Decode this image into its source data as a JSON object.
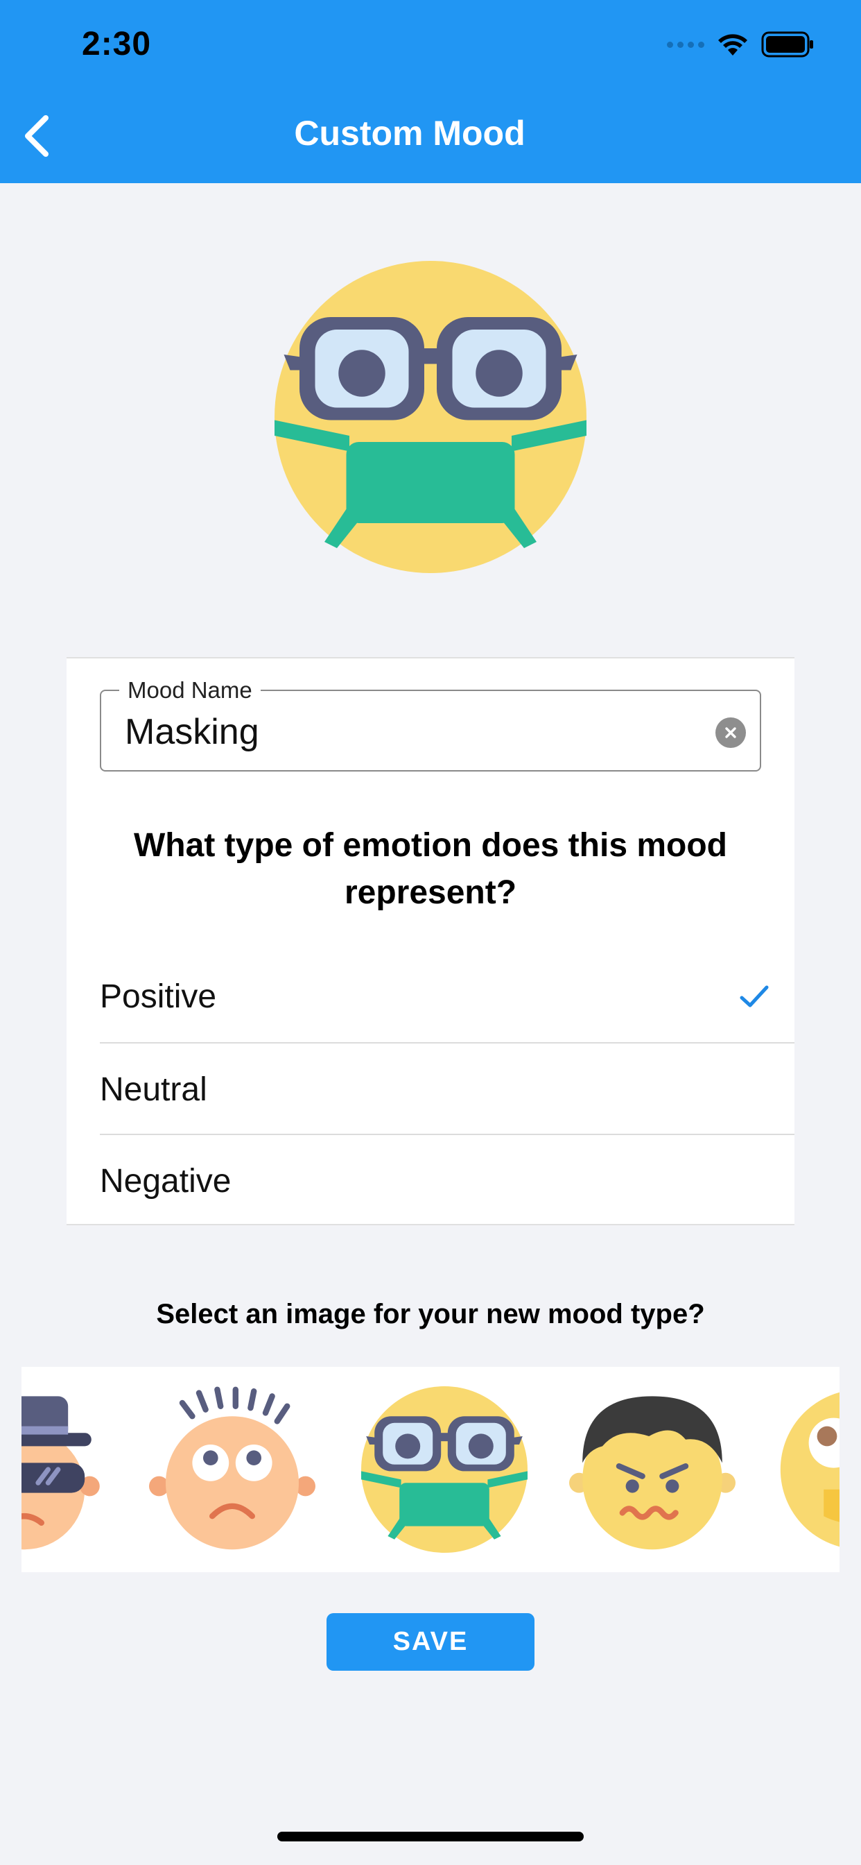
{
  "status_bar": {
    "time": "2:30"
  },
  "header": {
    "title": "Custom Mood",
    "back_icon": "chevron-left-icon"
  },
  "hero": {
    "icon": "masked-face-with-glasses-icon"
  },
  "form": {
    "mood_name_label": "Mood Name",
    "mood_name_value": "Masking",
    "clear_icon": "clear-circle-icon",
    "question": "What type of emotion does this mood represent?",
    "options": [
      {
        "label": "Positive",
        "selected": true
      },
      {
        "label": "Neutral",
        "selected": false
      },
      {
        "label": "Negative",
        "selected": false
      }
    ],
    "check_icon": "checkmark-icon"
  },
  "image_picker": {
    "title": "Select an image for your new mood type?",
    "faces": [
      "spy-face-icon",
      "worried-face-icon",
      "masked-face-with-glasses-icon",
      "angry-face-icon",
      "silly-face-icon"
    ],
    "selected_index": 2
  },
  "save_button": {
    "label": "SAVE"
  },
  "colors": {
    "primary": "#2196F3",
    "background": "#F2F3F7",
    "face_yellow": "#F9D970",
    "mask_green": "#28BC96",
    "glasses_dark": "#585D7F",
    "skin": "#FCC597"
  }
}
